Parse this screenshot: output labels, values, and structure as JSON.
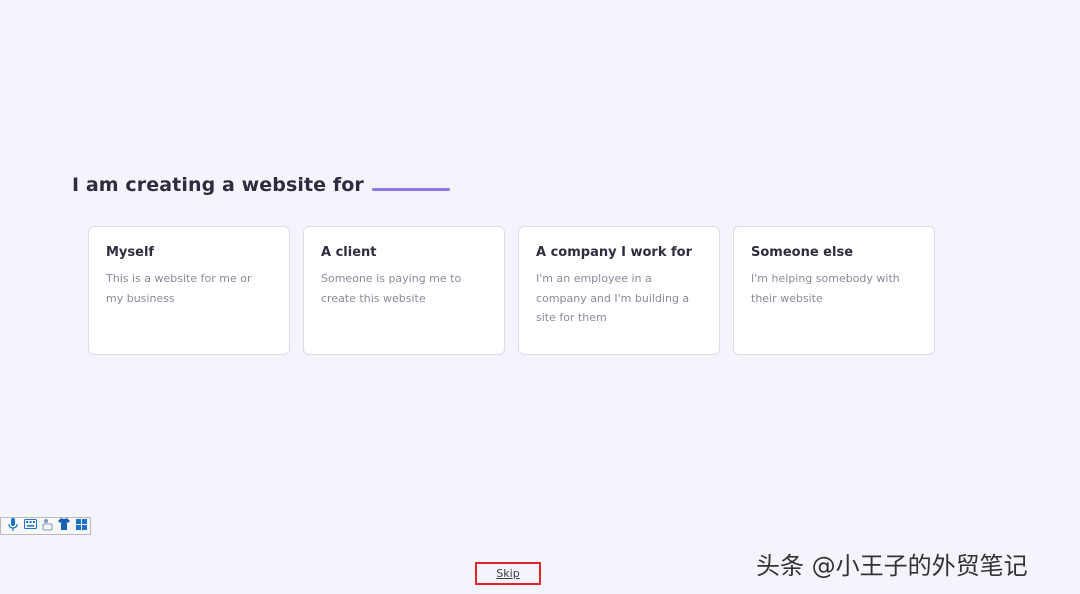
{
  "colors": {
    "accent": "#8b78e6",
    "background": "#f4f4fc",
    "highlight_box": "#e0232e"
  },
  "prompt": {
    "text": "I am creating a website for"
  },
  "options": [
    {
      "title": "Myself",
      "description": "This is a website for me or my business"
    },
    {
      "title": "A client",
      "description": "Someone is paying me to create this website"
    },
    {
      "title": "A company I work for",
      "description": "I'm an employee in a company and I'm building a site for them"
    },
    {
      "title": "Someone else",
      "description": "I'm helping somebody with their website"
    }
  ],
  "skip": {
    "label": "Skip"
  },
  "ime_toolbar": {
    "icons": [
      "microphone-icon",
      "keyboard-icon",
      "handwriting-icon",
      "shirt-icon",
      "grid-icon"
    ]
  },
  "watermark": {
    "text": "头条 @小王子的外贸笔记"
  }
}
